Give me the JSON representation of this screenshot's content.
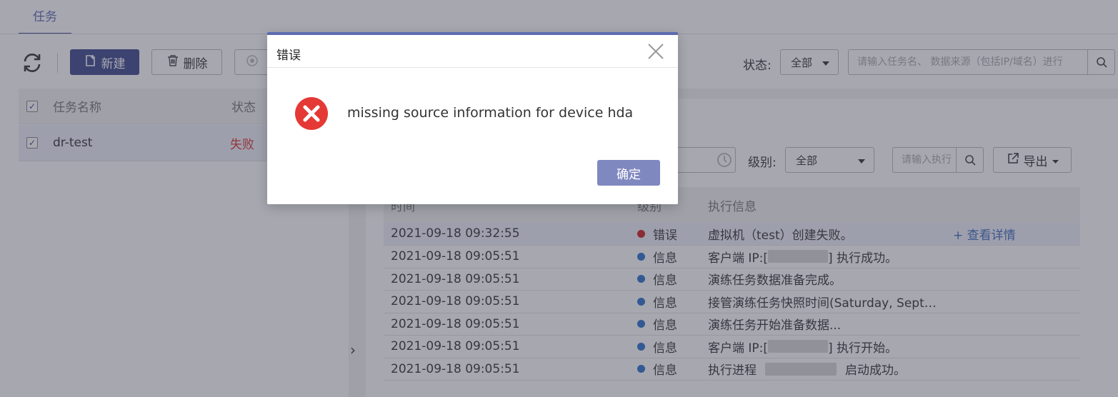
{
  "tabs": {
    "task": "任务"
  },
  "toolbar": {
    "new_label": "新建",
    "delete_label": "删除"
  },
  "filter": {
    "status_label": "状态:",
    "status_value": "全部",
    "search_placeholder": "请输入任务名、 数据来源（包括IP/域名）进行"
  },
  "tasks": {
    "headers": {
      "name": "任务名称",
      "status": "状态"
    },
    "rows": [
      {
        "name": "dr-test",
        "status": "失败",
        "checked": true
      }
    ]
  },
  "detail": {
    "level_label": "级别:",
    "level_value": "全部",
    "search_placeholder": "请输入执行",
    "export_label": "导出",
    "log_headers": {
      "time": "时间",
      "level": "级别",
      "info": "执行信息"
    },
    "logs": [
      {
        "time": "2021-09-18 09:32:55",
        "level": "错误",
        "info": "虚拟机（test）创建失败。",
        "link": "+ 查看详情",
        "color": "#cc2222"
      },
      {
        "time": "2021-09-18 09:05:51",
        "level": "信息",
        "info_pre": "客户端 IP:[",
        "info_post": "] 执行成功。",
        "color": "#2a72c9"
      },
      {
        "time": "2021-09-18 09:05:51",
        "level": "信息",
        "info": "演练任务数据准备完成。",
        "color": "#2a72c9"
      },
      {
        "time": "2021-09-18 09:05:51",
        "level": "信息",
        "info": "接管演练任务快照时间(Saturday, Sept…",
        "color": "#2a72c9"
      },
      {
        "time": "2021-09-18 09:05:51",
        "level": "信息",
        "info": "演练任务开始准备数据...",
        "color": "#2a72c9"
      },
      {
        "time": "2021-09-18 09:05:51",
        "level": "信息",
        "info_pre": "客户端 IP:[",
        "info_post": "] 执行开始。",
        "color": "#2a72c9"
      },
      {
        "time": "2021-09-18 09:05:51",
        "level": "信息",
        "info_pre": "执行进程",
        "info_post": "启动成功。",
        "color": "#2a72c9"
      }
    ]
  },
  "dialog": {
    "title": "错误",
    "message": "missing source information for device hda",
    "ok_label": "确定"
  }
}
